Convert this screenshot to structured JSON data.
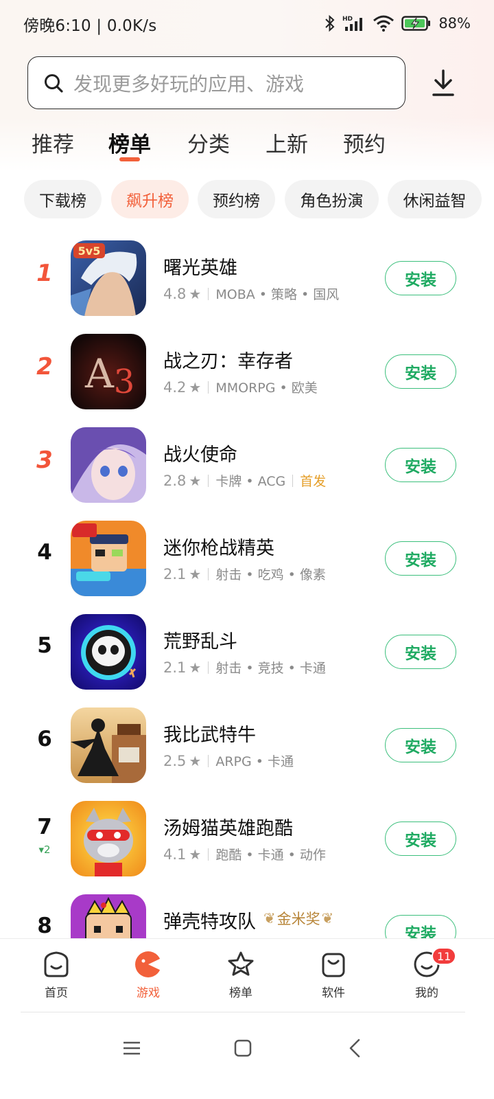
{
  "status_bar": {
    "time_speed": "傍晚6:10 | 0.0K/s",
    "battery": "88%",
    "icons": [
      "bluetooth-icon",
      "hd-signal-icon",
      "wifi-icon",
      "battery-charging-icon"
    ]
  },
  "search": {
    "placeholder": "发现更多好玩的应用、游戏",
    "icon": "search-icon"
  },
  "download_icon": "download-icon",
  "tabs": [
    {
      "label": "推荐",
      "active": false
    },
    {
      "label": "榜单",
      "active": true
    },
    {
      "label": "分类",
      "active": false
    },
    {
      "label": "上新",
      "active": false
    },
    {
      "label": "预约",
      "active": false
    }
  ],
  "chips": [
    {
      "label": "下载榜",
      "active": false
    },
    {
      "label": "飙升榜",
      "active": true
    },
    {
      "label": "预约榜",
      "active": false
    },
    {
      "label": "角色扮演",
      "active": false
    },
    {
      "label": "休闲益智",
      "active": false
    }
  ],
  "apps": [
    {
      "rank": "1",
      "name": "曙光英雄",
      "rating": "4.8",
      "tags": "MOBA • 策略 • 国风",
      "extra_tag": "",
      "install": "安装"
    },
    {
      "rank": "2",
      "name": "战之刃：幸存者",
      "rating": "4.2",
      "tags": "MMORPG • 欧美",
      "extra_tag": "",
      "install": "安装"
    },
    {
      "rank": "3",
      "name": "战火使命",
      "rating": "2.8",
      "tags": "卡牌 • ACG",
      "extra_tag": "首发",
      "install": "安装"
    },
    {
      "rank": "4",
      "name": "迷你枪战精英",
      "rating": "2.1",
      "tags": "射击 • 吃鸡 • 像素",
      "extra_tag": "",
      "install": "安装"
    },
    {
      "rank": "5",
      "name": "荒野乱斗",
      "rating": "2.1",
      "tags": "射击 • 竞技 • 卡通",
      "extra_tag": "",
      "install": "安装"
    },
    {
      "rank": "6",
      "name": "我比武特牛",
      "rating": "2.5",
      "tags": "ARPG • 卡通",
      "extra_tag": "",
      "install": "安装"
    },
    {
      "rank": "7",
      "rank_change": "▾2",
      "name": "汤姆猫英雄跑酷",
      "rating": "4.1",
      "tags": "跑酷 • 卡通 • 动作",
      "extra_tag": "",
      "install": "安装"
    },
    {
      "rank": "8",
      "name": "弹壳特攻队",
      "award": "金米奖",
      "install": "安装"
    }
  ],
  "bottom_nav": [
    {
      "label": "首页",
      "icon": "home-icon",
      "active": false
    },
    {
      "label": "游戏",
      "icon": "games-icon",
      "active": true
    },
    {
      "label": "榜单",
      "icon": "star-ranking-icon",
      "active": false
    },
    {
      "label": "软件",
      "icon": "shopping-bag-icon",
      "active": false
    },
    {
      "label": "我的",
      "icon": "profile-icon",
      "active": false,
      "badge": "11"
    }
  ],
  "system_nav": [
    "menu-icon",
    "home-square-icon",
    "back-icon"
  ],
  "colors": {
    "accent": "#f2603a",
    "install_green": "#1faa62",
    "top_rank_red": "#f2553a",
    "first_release_tag": "#e59f2a",
    "badge_red": "#f23c3c"
  }
}
